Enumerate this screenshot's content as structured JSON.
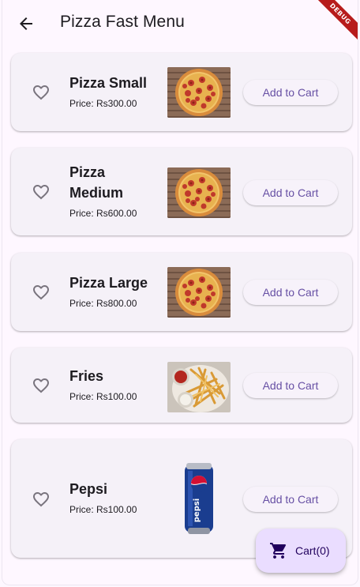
{
  "app_bar": {
    "title": "Pizza Fast Menu",
    "back_icon": "arrow-back-icon",
    "debug_label": "DEBUG"
  },
  "items": [
    {
      "name": "Pizza Small",
      "price": "Price: Rs300.00",
      "button": "Add to Cart",
      "image": "pepperoni-pizza"
    },
    {
      "name": "Pizza Medium",
      "price": "Price: Rs600.00",
      "button": "Add to Cart",
      "image": "pepperoni-pizza"
    },
    {
      "name": "Pizza Large",
      "price": "Price: Rs800.00",
      "button": "Add to Cart",
      "image": "pepperoni-pizza"
    },
    {
      "name": "Fries",
      "price": "Price: Rs100.00",
      "button": "Add to Cart",
      "image": "french-fries"
    },
    {
      "name": "Pepsi",
      "price": "Price: Rs100.00",
      "button": "Add to Cart",
      "image": "pepsi-can"
    }
  ],
  "fab": {
    "label": "Cart(0)",
    "icon": "shopping-cart-icon"
  },
  "colors": {
    "background": "#fef7ff",
    "card": "#f5f1f8",
    "accent": "#6750a4",
    "fab": "#eaddff",
    "debug": "#b71c1c"
  }
}
